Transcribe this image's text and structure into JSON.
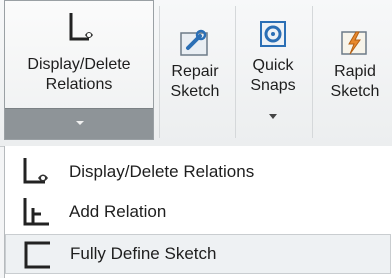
{
  "ribbon": {
    "display_delete": {
      "label_line1": "Display/Delete",
      "label_line2": "Relations",
      "icon": "display-relations-icon"
    },
    "repair_sketch": {
      "label_line1": "Repair",
      "label_line2": "Sketch",
      "icon": "repair-sketch-icon"
    },
    "quick_snaps": {
      "label_line1": "Quick",
      "label_line2": "Snaps",
      "icon": "quick-snaps-icon"
    },
    "rapid_sketch": {
      "label_line1": "Rapid",
      "label_line2": "Sketch",
      "icon": "rapid-sketch-icon"
    }
  },
  "menu": {
    "items": [
      {
        "label": "Display/Delete Relations",
        "icon": "display-relations-icon"
      },
      {
        "label": "Add Relation",
        "icon": "add-relation-icon"
      },
      {
        "label": "Fully Define Sketch",
        "icon": "fully-define-sketch-icon"
      }
    ]
  },
  "colors": {
    "menu_bg": "#ffffff",
    "ribbon_bg": "#f2f3f4",
    "accent_blue": "#2b6fb5",
    "accent_orange": "#e8892c"
  }
}
